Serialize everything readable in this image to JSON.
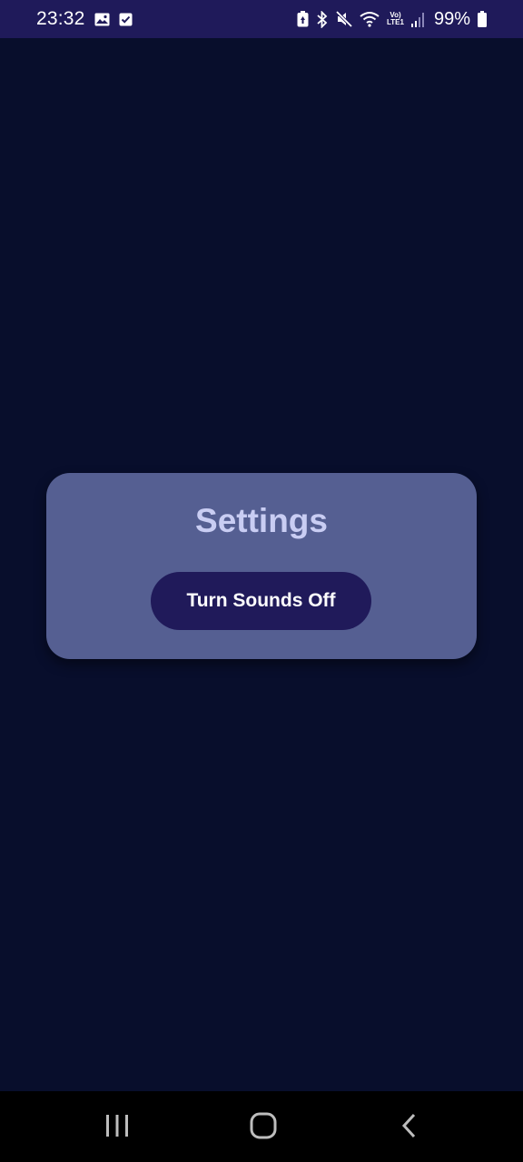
{
  "status_bar": {
    "time": "23:32",
    "battery_percent": "99%",
    "network_label_top": "Vo)",
    "network_label_bottom": "LTE1",
    "left_icons": [
      "image-icon",
      "checkbox-icon"
    ],
    "right_icons": [
      "battery-saver-icon",
      "bluetooth-icon",
      "mute-icon",
      "wifi-icon",
      "signal-icon",
      "battery-icon"
    ]
  },
  "settings_card": {
    "title": "Settings",
    "sound_button_label": "Turn Sounds Off"
  },
  "navigation_bar": {
    "buttons": [
      "recent-apps-icon",
      "home-icon",
      "back-icon"
    ]
  },
  "colors": {
    "background": "#080e2c",
    "status_bar": "#1f1a5a",
    "card": "#555f92",
    "title": "#c9cdf3",
    "button": "#201a5a",
    "button_text": "#ffffff",
    "nav_bar": "#000000"
  }
}
